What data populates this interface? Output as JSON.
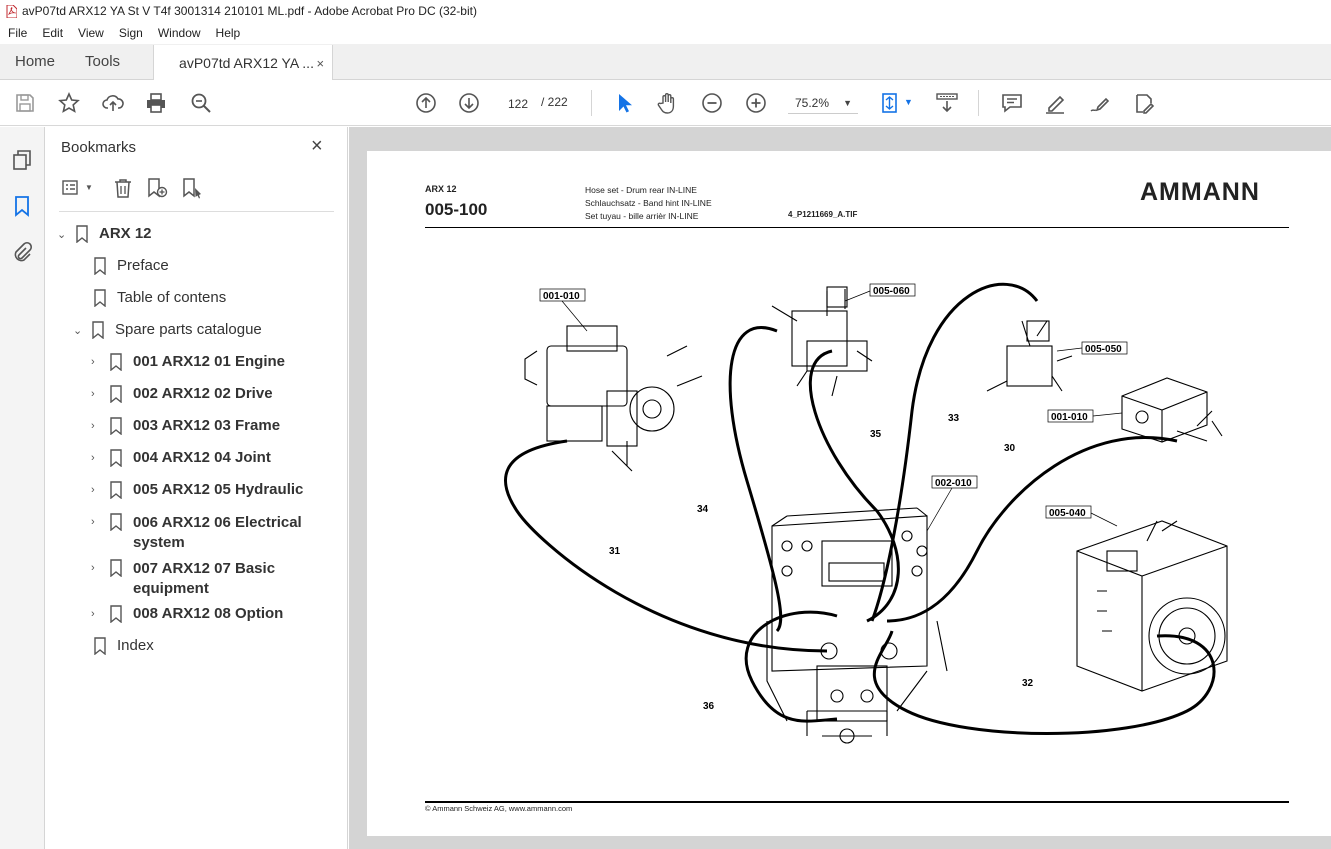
{
  "window": {
    "title": "avP07td ARX12 YA St V T4f 3001314 210101 ML.pdf - Adobe Acrobat Pro DC (32-bit)"
  },
  "menu": [
    "File",
    "Edit",
    "View",
    "Sign",
    "Window",
    "Help"
  ],
  "tabs": {
    "home": "Home",
    "tools": "Tools",
    "document": "avP07td ARX12 YA ...",
    "close": "×"
  },
  "toolbar": {
    "page_current": "122",
    "page_total": "/  222",
    "zoom": "75.2%"
  },
  "bookmarks": {
    "title": "Bookmarks",
    "close": "×",
    "items": [
      {
        "label": "ARX 12"
      },
      {
        "label": "Preface"
      },
      {
        "label": "Table of contens"
      },
      {
        "label": "Spare parts catalogue"
      },
      {
        "label": "001 ARX12 01 Engine"
      },
      {
        "label": "002 ARX12 02 Drive"
      },
      {
        "label": "003 ARX12 03 Frame"
      },
      {
        "label": "004 ARX12 04 Joint"
      },
      {
        "label": "005 ARX12 05 Hydraulic"
      },
      {
        "label": "006 ARX12 06 Electrical",
        "label2": "system"
      },
      {
        "label": "007 ARX12 07 Basic",
        "label2": "equipment"
      },
      {
        "label": "008 ARX12 08 Option"
      },
      {
        "label": "Index"
      }
    ]
  },
  "page": {
    "model": "ARX 12",
    "code": "005-100",
    "desc_en": "Hose set - Drum rear IN-LINE",
    "desc_de": "Schlauchsatz - Band hint IN-LINE",
    "desc_fr": "Set tuyau - bille arrièr IN-LINE",
    "file": "4_P1211669_A.TIF",
    "logo": "AMMANN",
    "footer": "© Ammann Schweiz AG, www.ammann.com",
    "callouts": [
      "001-010",
      "005-060",
      "005-050",
      "001-010",
      "002-010",
      "005-040"
    ],
    "numbers": [
      "33",
      "35",
      "30",
      "34",
      "31",
      "32",
      "36"
    ]
  },
  "icons": {
    "titlebar": "pdf-icon",
    "toolbar": [
      "save-icon",
      "star-icon",
      "upload-icon",
      "print-icon",
      "zoom-search-icon",
      "prev-page-icon",
      "next-page-icon",
      "select-arrow-icon",
      "hand-icon",
      "zoom-out-icon",
      "zoom-in-icon",
      "fit-page-icon",
      "scroll-mode-icon",
      "comment-icon",
      "highlight-icon",
      "sign-icon",
      "edit-icon"
    ],
    "rail": [
      "pages-icon",
      "bookmark-icon",
      "attachment-icon"
    ]
  }
}
